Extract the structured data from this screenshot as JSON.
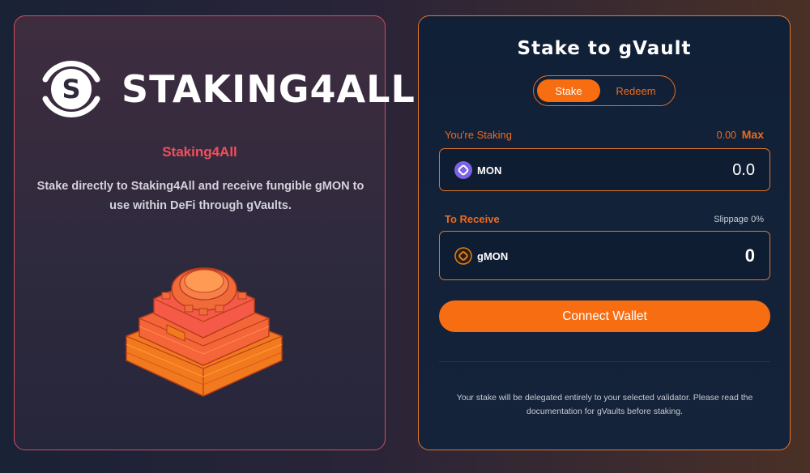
{
  "brand": {
    "logo_text": "STAKING4ALL",
    "title": "Staking4All",
    "description": "Stake directly to Staking4All and receive fungible gMON to use within DeFi through gVaults."
  },
  "panel": {
    "title": "Stake to gVault",
    "tabs": {
      "stake": "Stake",
      "redeem": "Redeem",
      "active": "Stake"
    },
    "staking_label": "You're Staking",
    "balance": "0.00",
    "max_label": "Max",
    "stake_token": {
      "name": "MON",
      "icon": "mon-token-icon",
      "amount": "0.0"
    },
    "receive_label": "To Receive",
    "slippage": "Slippage 0%",
    "receive_token": {
      "name": "gMON",
      "icon": "gmon-token-icon",
      "amount": "0"
    },
    "connect_label": "Connect Wallet",
    "note": "Your stake will be delegated entirely to your selected validator. Please read the documentation for gVaults before staking."
  },
  "colors": {
    "accent": "#f76d12",
    "title_red": "#f0505a",
    "card_border_left": "#d24e5c",
    "card_border_right": "#e1762c"
  }
}
